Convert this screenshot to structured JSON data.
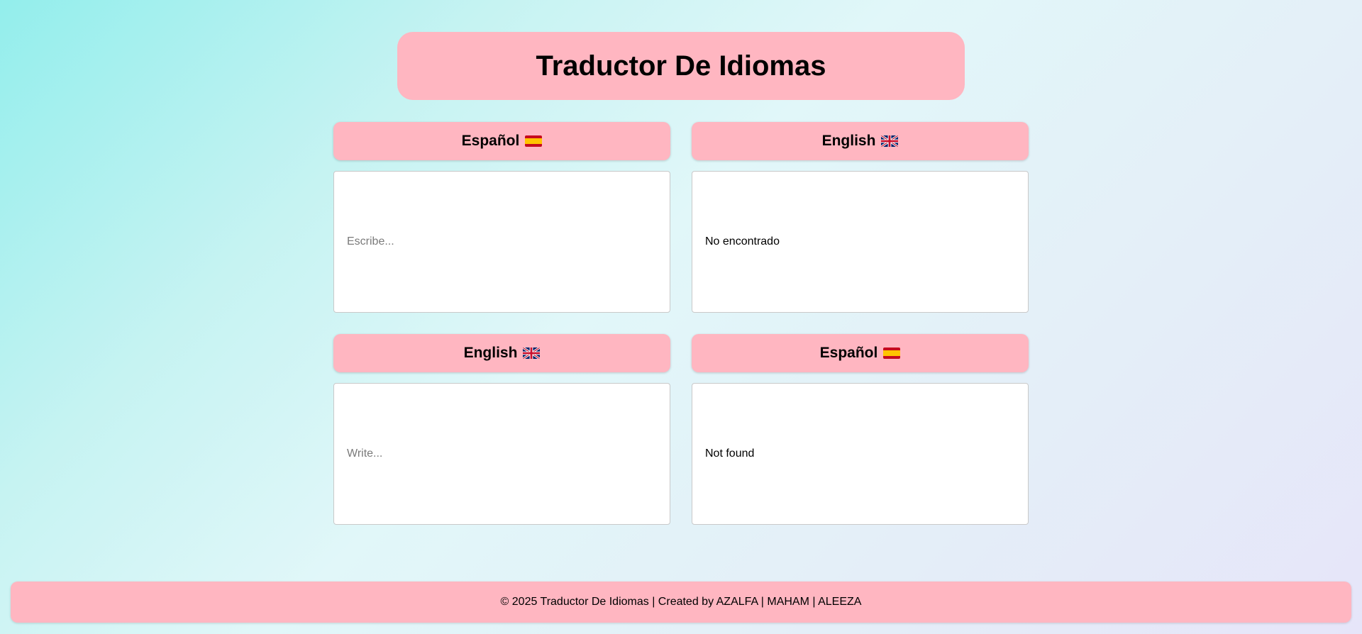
{
  "header": {
    "title": "Traductor De Idiomas"
  },
  "translators": [
    {
      "source_label": "Español",
      "source_flag": "spain-flag-icon",
      "input_placeholder": "Escribe...",
      "input_value": "",
      "target_label": "English",
      "target_flag": "uk-flag-icon",
      "output_text": "No encontrado"
    },
    {
      "source_label": "English",
      "source_flag": "uk-flag-icon",
      "input_placeholder": "Write...",
      "input_value": "",
      "target_label": "Español",
      "target_flag": "spain-flag-icon",
      "output_text": "Not found"
    }
  ],
  "footer": {
    "text": "© 2025 Traductor De Idiomas | Created by AZALFA | MAHAM | ALEEZA"
  },
  "colors": {
    "panel_pink": "#ffb6c1",
    "background_start": "#93eeec",
    "background_end": "#e6e5f9"
  }
}
